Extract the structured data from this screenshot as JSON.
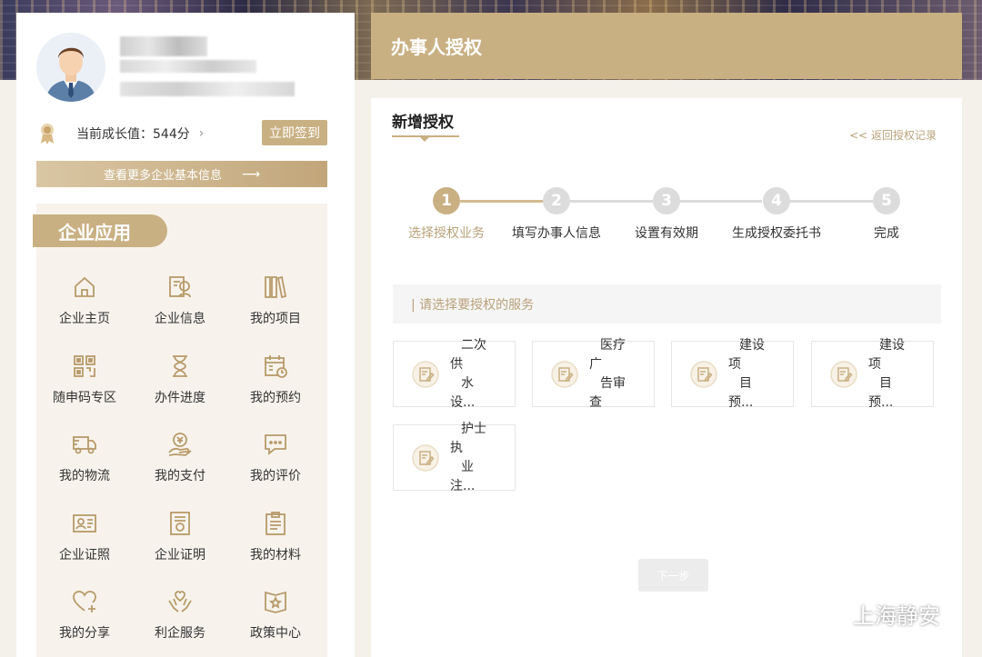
{
  "profile": {
    "growth_label": "当前成长值：544分",
    "growth_arrow": "›",
    "signin_button": "立即签到",
    "more_info_button": "查看更多企业基本信息",
    "more_info_arrow": "⟶"
  },
  "apps": {
    "title": "企业应用",
    "items": [
      {
        "label": "企业主页",
        "icon": "home-icon"
      },
      {
        "label": "企业信息",
        "icon": "enterprise-info-icon"
      },
      {
        "label": "我的项目",
        "icon": "books-icon"
      },
      {
        "label": "随申码专区",
        "icon": "qr-code-icon"
      },
      {
        "label": "办件进度",
        "icon": "hourglass-icon"
      },
      {
        "label": "我的预约",
        "icon": "calendar-icon"
      },
      {
        "label": "我的物流",
        "icon": "truck-icon"
      },
      {
        "label": "我的支付",
        "icon": "payment-icon"
      },
      {
        "label": "我的评价",
        "icon": "comment-icon"
      },
      {
        "label": "企业证照",
        "icon": "id-card-icon"
      },
      {
        "label": "企业证明",
        "icon": "certificate-icon"
      },
      {
        "label": "我的材料",
        "icon": "clipboard-icon"
      },
      {
        "label": "我的分享",
        "icon": "heart-plus-icon"
      },
      {
        "label": "利企服务",
        "icon": "hands-heart-icon"
      },
      {
        "label": "政策中心",
        "icon": "policy-star-icon"
      }
    ]
  },
  "header": {
    "title": "办事人授权"
  },
  "main": {
    "subtitle": "新增授权",
    "back_link": "<< 返回授权记录",
    "steps": [
      {
        "num": "1",
        "label": "选择授权业务",
        "active": true
      },
      {
        "num": "2",
        "label": "填写办事人信息",
        "active": false
      },
      {
        "num": "3",
        "label": "设置有效期",
        "active": false
      },
      {
        "num": "4",
        "label": "生成授权委托书",
        "active": false
      },
      {
        "num": "5",
        "label": "完成",
        "active": false
      }
    ],
    "prompt": "| 请选择要授权的服务",
    "services": [
      {
        "line1": "二次供",
        "line2": "水设..."
      },
      {
        "line1": "医疗广",
        "line2": "告审查"
      },
      {
        "line1": "建设项",
        "line2": "目预..."
      },
      {
        "line1": "建设项",
        "line2": "目预..."
      },
      {
        "line1": "护士执",
        "line2": "业注..."
      }
    ],
    "next_button": "下一步"
  },
  "watermark": {
    "text": "上海静安",
    "icon": "wechat-icon"
  },
  "colors": {
    "accent": "#c9b083",
    "inactive_step": "#dcdcdc",
    "accent_text": "#b8a27a"
  }
}
